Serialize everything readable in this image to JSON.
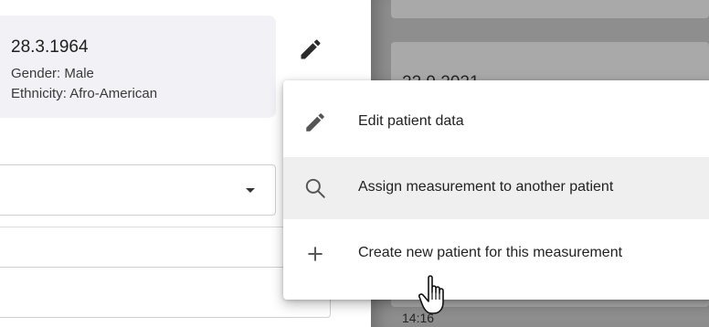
{
  "patient": {
    "dob": "28.3.1964",
    "gender": "Gender: Male",
    "ethnicity": "Ethnicity: Afro-American"
  },
  "background": {
    "date": "22.9.2021",
    "time": "14:16"
  },
  "menu": {
    "items": [
      {
        "label": "Edit patient data",
        "icon": "pencil-icon"
      },
      {
        "label": "Assign measurement to another patient",
        "icon": "search-icon"
      },
      {
        "label": "Create new patient for this measurement",
        "icon": "plus-icon"
      }
    ]
  },
  "icons": {
    "edit": "pencil-icon",
    "dropdown": "caret-down-icon",
    "cursor": "hand-pointer-icon"
  },
  "colors": {
    "card_bg": "#f1f1f6",
    "overlay": "#8e8e8e",
    "hover": "#efefef"
  }
}
